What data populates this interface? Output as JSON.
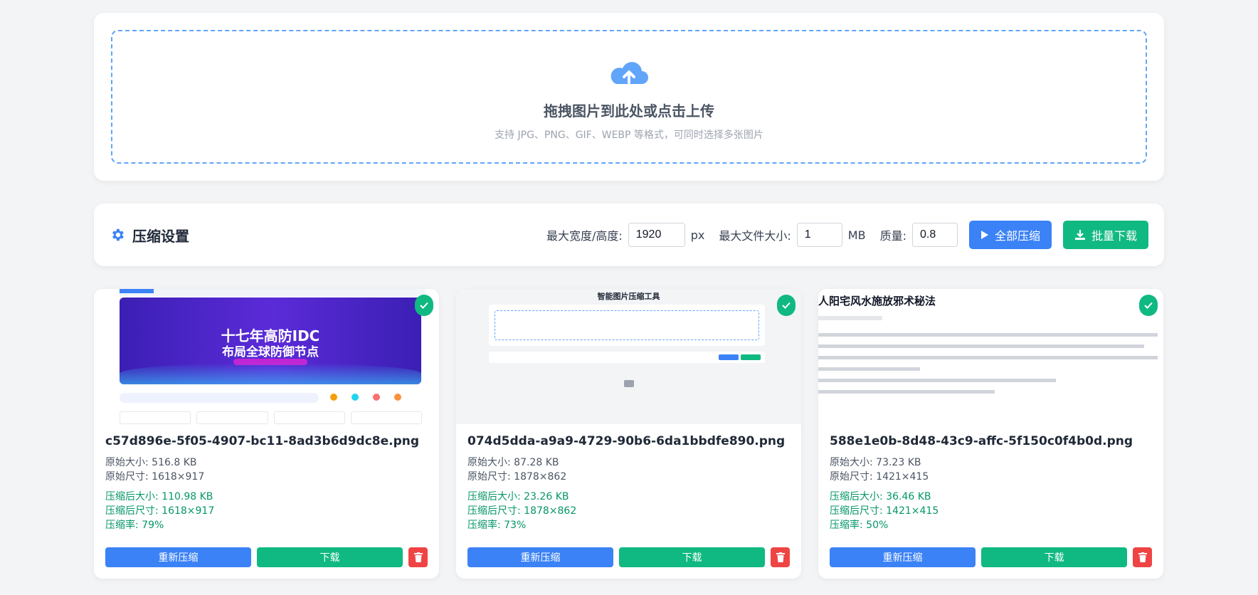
{
  "upload": {
    "title": "拖拽图片到此处或点击上传",
    "hint": "支持 JPG、PNG、GIF、WEBP 等格式，可同时选择多张图片",
    "icon": "cloud-upload-icon"
  },
  "settings": {
    "title": "压缩设置",
    "icon": "gear-icon",
    "max_dim_label": "最大宽度/高度:",
    "max_dim_value": "1920",
    "max_dim_unit": "px",
    "max_size_label": "最大文件大小:",
    "max_size_value": "1",
    "max_size_unit": "MB",
    "quality_label": "质量:",
    "quality_value": "0.8",
    "compress_all_label": "全部压缩",
    "batch_download_label": "批量下载"
  },
  "colors": {
    "primary": "#3b82f6",
    "success": "#10b981",
    "danger": "#ef4444",
    "success_text": "#059669"
  },
  "cards": [
    {
      "filename": "c57d896e-5f05-4907-bc11-8ad3b6d9dc8e.png",
      "orig_size": "原始大小: 516.8 KB",
      "orig_dim": "原始尺寸: 1618×917",
      "comp_size": "压缩后大小: 110.98 KB",
      "comp_dim": "压缩后尺寸: 1618×917",
      "ratio": "压缩率: 79%",
      "thumb_h1": "十七年高防IDC",
      "thumb_h2": "布局全球防御节点"
    },
    {
      "filename": "074d5dda-a9a9-4729-90b6-6da1bbdfe890.png",
      "orig_size": "原始大小: 87.28 KB",
      "orig_dim": "原始尺寸: 1878×862",
      "comp_size": "压缩后大小: 23.26 KB",
      "comp_dim": "压缩后尺寸: 1878×862",
      "ratio": "压缩率: 73%",
      "thumb_title": "智能图片压缩工具"
    },
    {
      "filename": "588e1e0b-8d48-43c9-affc-5f150c0f4b0d.png",
      "orig_size": "原始大小: 73.23 KB",
      "orig_dim": "原始尺寸: 1421×415",
      "comp_size": "压缩后大小: 36.46 KB",
      "comp_dim": "压缩后尺寸: 1421×415",
      "ratio": "压缩率: 50%",
      "thumb_title": "人阳宅风水施放邪术秘法"
    }
  ],
  "card_actions": {
    "recompress_label": "重新压缩",
    "download_label": "下载"
  }
}
